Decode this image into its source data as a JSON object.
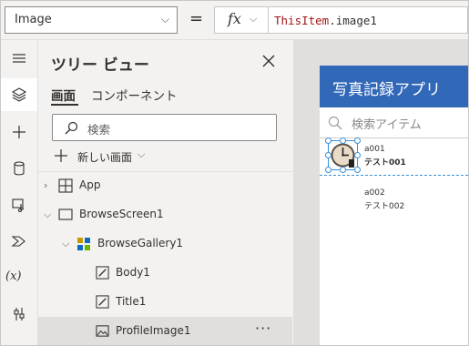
{
  "formula_bar": {
    "property_value": "Image",
    "equals": "=",
    "fx_label": "fx",
    "formula_keyword": "ThisItem",
    "formula_rest": ".image1"
  },
  "rail": {
    "items": [
      "hamburger-menu",
      "layers",
      "insert",
      "data",
      "media",
      "power-automate",
      "variables",
      "advanced-tools"
    ],
    "variables_label": "(x)"
  },
  "tree": {
    "title": "ツリー ビュー",
    "tabs": [
      "画面",
      "コンポーネント"
    ],
    "search_placeholder": "検索",
    "new_screen_label": "新しい画面",
    "items": [
      {
        "label": "App"
      },
      {
        "label": "BrowseScreen1"
      },
      {
        "label": "BrowseGallery1"
      },
      {
        "label": "Body1"
      },
      {
        "label": "Title1"
      },
      {
        "label": "ProfileImage1",
        "more": "···"
      }
    ]
  },
  "app": {
    "header_title": "写真記録アプリ",
    "search_placeholder": "検索アイテム",
    "gallery": [
      {
        "title": "a001",
        "subtitle": "テスト001"
      },
      {
        "title": "a002",
        "subtitle": "テスト002"
      }
    ]
  },
  "colors": {
    "accent": "#3268b8",
    "selection": "#3b8fd9",
    "formula_keyword": "#a31515"
  }
}
